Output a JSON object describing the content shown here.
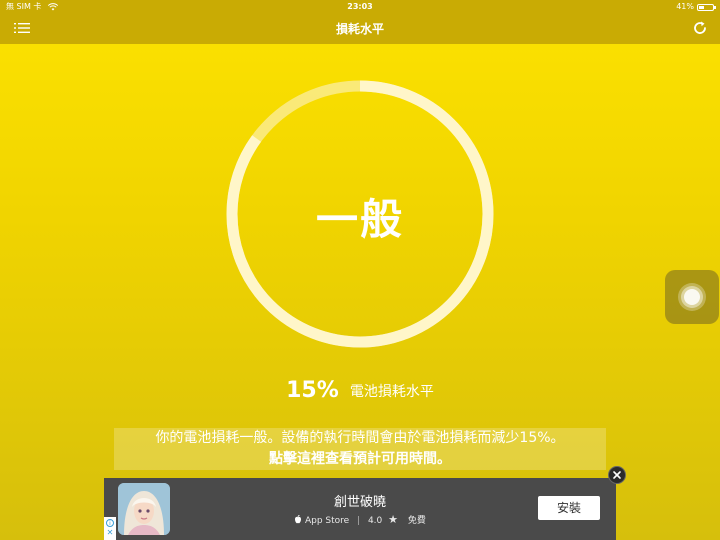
{
  "status_bar": {
    "carrier": "無 SIM 卡",
    "time": "23:03",
    "battery_pct": "41%",
    "battery_level": 0.41
  },
  "nav": {
    "title": "損耗水平",
    "menu_icon": "list-icon",
    "refresh_icon": "refresh-icon"
  },
  "gauge": {
    "level_text": "一般",
    "arc_fraction": 0.85,
    "color_track": "#fbeea0",
    "color_arc": "#fff6c9"
  },
  "battery_wear": {
    "percent": "15%",
    "label": "電池損耗水平"
  },
  "description": {
    "line1": "你的電池損耗一般。設備的執行時間會由於電池損耗而減少15%。",
    "line2": "點擊這裡查看預計可用時間。"
  },
  "ad": {
    "title": "創世破曉",
    "store": "App Store",
    "rating": "4.0",
    "price": "免費",
    "install_label": "安裝",
    "close_icon": "close-icon",
    "adchoices_i": "i",
    "adchoices_x": "✕"
  },
  "colors": {
    "background": "#f0d400",
    "nav_bar": "#c9ab04",
    "ad_bg": "#4a4a4a"
  }
}
